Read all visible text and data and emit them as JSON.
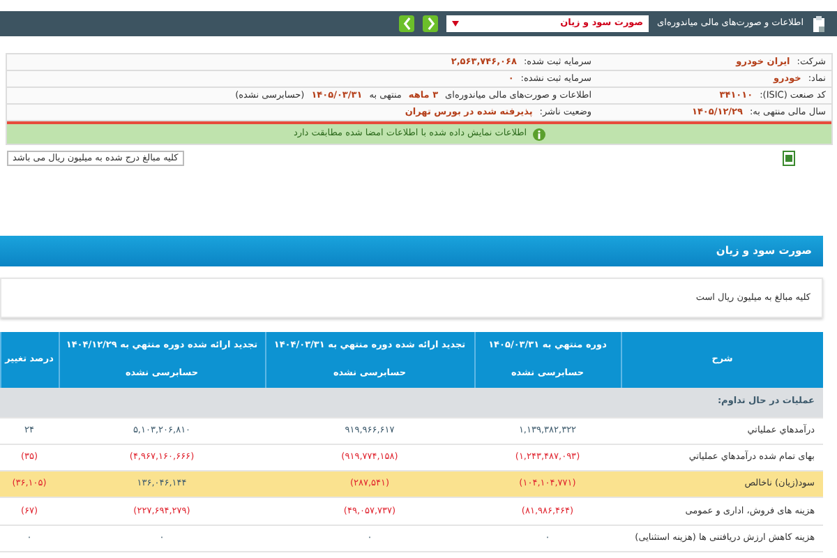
{
  "header": {
    "title": "اطلاعات و صورت‌های مالی میاندوره‌ای",
    "statement_select": "صورت سود و زیان"
  },
  "company_info": [
    {
      "right": [
        {
          "kind": "label",
          "text": "شرکت:"
        },
        {
          "kind": "value",
          "text": "ایران خودرو"
        }
      ],
      "left": [
        {
          "kind": "label",
          "text": "سرمایه ثبت شده:"
        },
        {
          "kind": "value",
          "text": "۲,۵۶۳,۷۴۶,۰۶۸"
        }
      ]
    },
    {
      "right": [
        {
          "kind": "label",
          "text": "نماد:"
        },
        {
          "kind": "value",
          "text": "خودرو"
        }
      ],
      "left": [
        {
          "kind": "label",
          "text": "سرمایه ثبت نشده:"
        },
        {
          "kind": "value",
          "text": "۰"
        }
      ]
    },
    {
      "right": [
        {
          "kind": "label",
          "text": "کد صنعت (ISIC):"
        },
        {
          "kind": "value",
          "text": "۳۴۱۰۱۰"
        }
      ],
      "left": [
        {
          "kind": "label",
          "text": "اطلاعات و صورت‌های مالی میاندوره‌ای"
        },
        {
          "kind": "value",
          "text": "۳ ماهه"
        },
        {
          "kind": "label",
          "text": "منتهی به"
        },
        {
          "kind": "value",
          "text": "۱۴۰۵/۰۳/۳۱"
        },
        {
          "kind": "label",
          "text": "(حسابرسی نشده)"
        }
      ]
    },
    {
      "right": [
        {
          "kind": "label",
          "text": "سال مالی منتهی به:"
        },
        {
          "kind": "value",
          "text": "۱۴۰۵/۱۲/۲۹"
        }
      ],
      "left": [
        {
          "kind": "label",
          "text": "وضعیت ناشر:"
        },
        {
          "kind": "value",
          "text": "پذیرفته شده در بورس تهران"
        }
      ]
    }
  ],
  "verification_alert": "اطلاعات نمایش داده شده با اطلاعات امضا شده مطابقت دارد",
  "unit_note": "کلیه مبالغ درج شده به میلیون ریال می باشد",
  "section_title": "صورت سود و زیان",
  "section_note": "کلیه مبالغ به میلیون ریال است",
  "table": {
    "columns": [
      "شرح",
      "دوره منتهي به ۱۴۰۵/۰۳/۳۱",
      "تجدید ارائه شده دوره منتهي به ۱۴۰۴/۰۳/۳۱",
      "تجدید ارائه شده دوره منتهي به ۱۴۰۴/۱۲/۲۹",
      "درصد تغییر"
    ],
    "subheaders": [
      "حسابرسی نشده",
      "حسابرسی نشده",
      "حسابرسی نشده"
    ],
    "rows": [
      {
        "kind": "section",
        "label": "عملیات در حال تداوم:"
      },
      {
        "kind": "data",
        "label": "درآمدهاي عملياتي",
        "highlighted": false,
        "values": [
          {
            "text": "۱,۱۳۹,۳۸۲,۳۲۲",
            "negative": false
          },
          {
            "text": "۹۱۹,۹۶۶,۶۱۷",
            "negative": false
          },
          {
            "text": "۵,۱۰۳,۲۰۶,۸۱۰",
            "negative": false
          },
          {
            "text": "۲۴",
            "negative": false
          }
        ]
      },
      {
        "kind": "data",
        "label": "بهاى تمام شده درآمدهاي عملياتي",
        "highlighted": false,
        "values": [
          {
            "text": "(۱,۲۴۳,۴۸۷,۰۹۳)",
            "negative": true
          },
          {
            "text": "(۹۱۹,۷۷۴,۱۵۸)",
            "negative": true
          },
          {
            "text": "(۴,۹۶۷,۱۶۰,۶۶۶)",
            "negative": true
          },
          {
            "text": "(۳۵)",
            "negative": true
          }
        ]
      },
      {
        "kind": "data",
        "label": "سود(زيان) ناخالص",
        "highlighted": true,
        "values": [
          {
            "text": "(۱۰۴,۱۰۴,۷۷۱)",
            "negative": true
          },
          {
            "text": "(۲۸۷,۵۴۱)",
            "negative": true
          },
          {
            "text": "۱۳۶,۰۴۶,۱۴۴",
            "negative": false
          },
          {
            "text": "(۳۶,۱۰۵)",
            "negative": true
          }
        ]
      },
      {
        "kind": "data",
        "label": "هزينه هاى فروش، ادارى و عمومى",
        "highlighted": false,
        "values": [
          {
            "text": "(۸۱,۹۸۶,۴۶۴)",
            "negative": true
          },
          {
            "text": "(۴۹,۰۵۷,۷۳۷)",
            "negative": true
          },
          {
            "text": "(۲۲۷,۶۹۴,۲۷۹)",
            "negative": true
          },
          {
            "text": "(۶۷)",
            "negative": true
          }
        ]
      },
      {
        "kind": "data",
        "label": "هزينه كاهش ارزش دريافتنى ها (هزينه استثنايى)",
        "highlighted": false,
        "values": [
          {
            "text": "۰",
            "negative": false
          },
          {
            "text": "۰",
            "negative": false
          },
          {
            "text": "۰",
            "negative": false
          },
          {
            "text": "۰",
            "negative": false
          }
        ]
      }
    ]
  }
}
